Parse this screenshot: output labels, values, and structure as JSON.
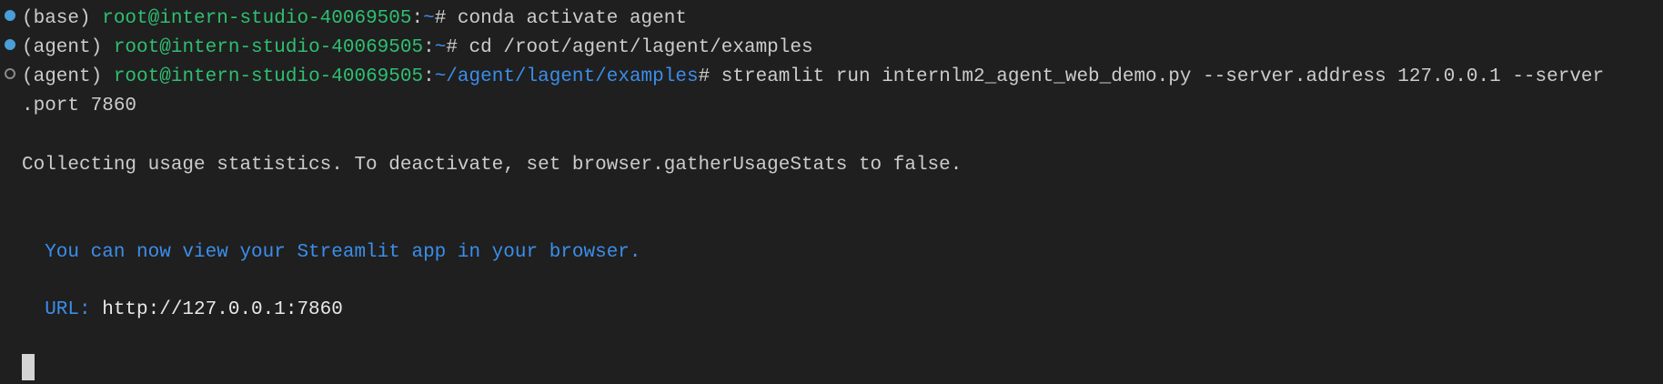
{
  "colors": {
    "background": "#1f1f1f",
    "text": "#cccccc",
    "prompt_user": "#2fbf71",
    "prompt_path": "#3b8eea",
    "info": "#3b8eea",
    "marker_done": "#4a9fd8",
    "marker_running": "#8a8a8a"
  },
  "lines": [
    {
      "marker": "filled",
      "env": "(base) ",
      "user": "root@intern-studio-40069505",
      "sep": ":",
      "path": "~",
      "hash": "# ",
      "command": "conda activate agent"
    },
    {
      "marker": "filled",
      "env": "(agent) ",
      "user": "root@intern-studio-40069505",
      "sep": ":",
      "path": "~",
      "hash": "# ",
      "command": "cd /root/agent/lagent/examples"
    },
    {
      "marker": "hollow",
      "env": "(agent) ",
      "user": "root@intern-studio-40069505",
      "sep": ":",
      "path": "~/agent/lagent/examples",
      "hash": "# ",
      "command": "streamlit run internlm2_agent_web_demo.py --server.address 127.0.0.1 --server",
      "command_wrap": ".port 7860"
    }
  ],
  "output": {
    "stats_message": "Collecting usage statistics. To deactivate, set browser.gatherUsageStats to false.",
    "view_message": "  You can now view your Streamlit app in your browser.",
    "url_label": "  URL: ",
    "url_value": "http://127.0.0.1:7860"
  }
}
